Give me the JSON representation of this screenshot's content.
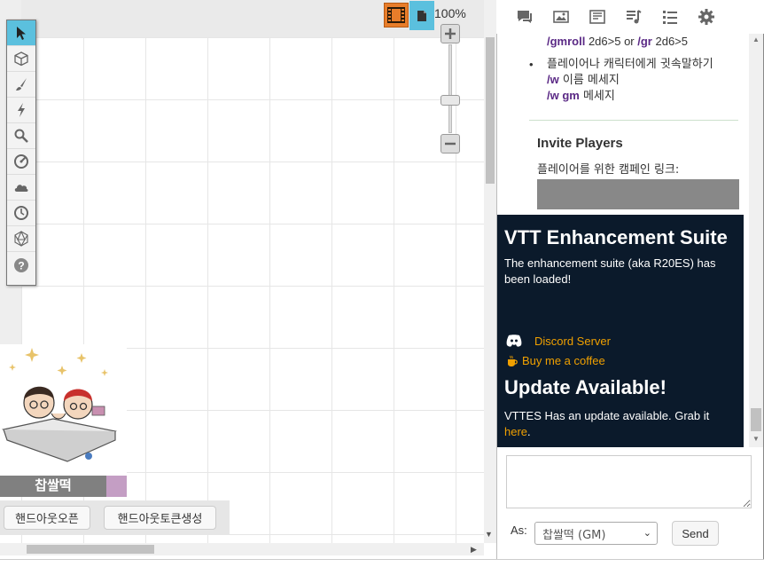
{
  "toolbar": {
    "tools": [
      {
        "icon": "pointer-icon",
        "active": true
      },
      {
        "icon": "cube-icon"
      },
      {
        "icon": "brush-icon"
      },
      {
        "icon": "lightning-icon"
      },
      {
        "icon": "magnifier-icon"
      },
      {
        "icon": "compass-icon"
      },
      {
        "icon": "cloud-icon"
      },
      {
        "icon": "clock-icon"
      },
      {
        "icon": "d20-icon"
      },
      {
        "icon": "help-icon"
      }
    ]
  },
  "canvas": {
    "zoom_label": "100%",
    "zoom_level_percent": 100
  },
  "character": {
    "name": "찹쌀떡",
    "color": "#c49ec4",
    "handout_buttons": [
      "핸드아웃오픈",
      "핸드아웃토큰생성"
    ]
  },
  "tabs": [
    "chat-icon",
    "art-icon",
    "journal-icon",
    "jukebox-icon",
    "list-icon",
    "gear-icon"
  ],
  "chat": {
    "gmroll_cmd1": "/gmroll",
    "gmroll_text1": " 2d6>5 or ",
    "gmroll_cmd2": "/gr",
    "gmroll_text2": " 2d6>5",
    "whisper_text": "플레이어나 캐릭터에게 귓속말하기",
    "whisper_cmd1": "/w",
    "whisper_arg1": " 이름 메세지",
    "whisper_cmd2": "/w gm",
    "whisper_arg2": " 메세지",
    "invite_title": "Invite Players",
    "invite_desc": "플레이어를 위한 캠페인 링크:",
    "vttes": {
      "title": "VTT Enhancement Suite",
      "loaded_text": "The enhancement suite (aka R20ES) has been loaded!",
      "discord_label": "Discord Server",
      "coffee_label": "Buy me a coffee",
      "update_title": "Update Available!",
      "update_text": "VTTES Has an update available. Grab it ",
      "update_link": "here",
      "update_end": "."
    }
  },
  "chat_form": {
    "as_label": "As:",
    "as_value": "찹쌀떡 (GM)",
    "send_label": "Send"
  }
}
